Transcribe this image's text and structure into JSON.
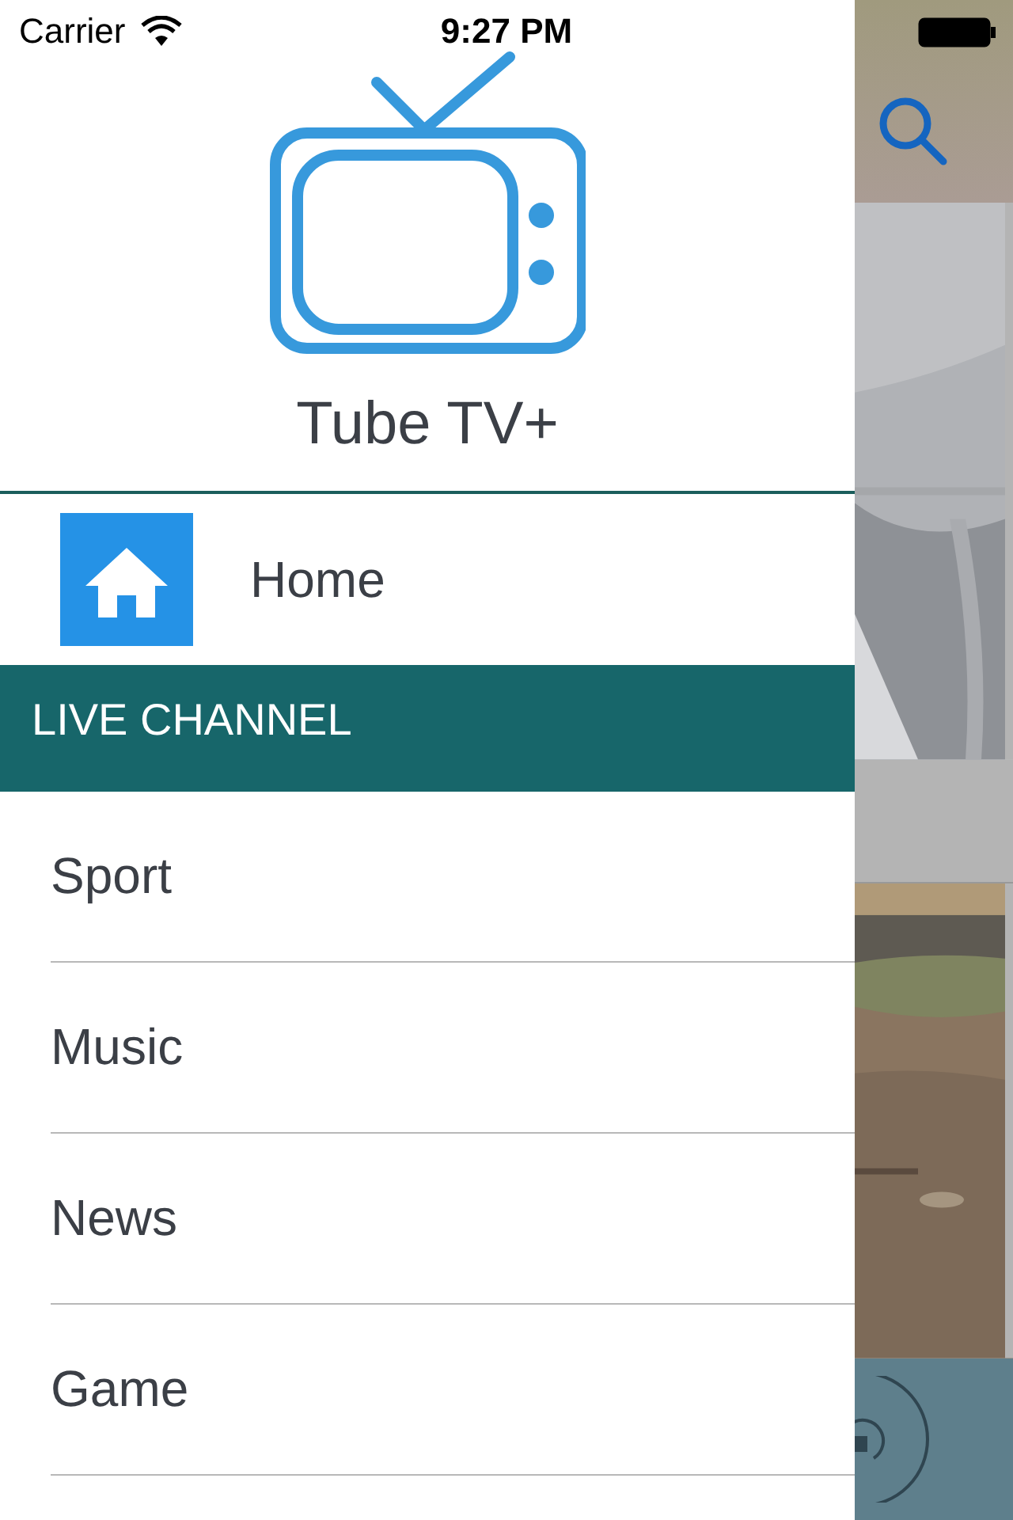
{
  "status_bar": {
    "carrier": "Carrier",
    "time": "9:27 PM"
  },
  "app": {
    "title": "Tube TV+"
  },
  "menu": {
    "home": {
      "label": "Home"
    },
    "section": "LIVE CHANNEL",
    "items": [
      {
        "label": "Sport"
      },
      {
        "label": "Music"
      },
      {
        "label": "News"
      },
      {
        "label": "Game"
      }
    ]
  }
}
